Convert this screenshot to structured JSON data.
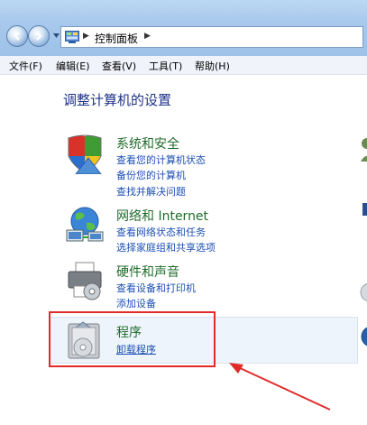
{
  "address_bar": {
    "path": "控制面板"
  },
  "menu": {
    "items": [
      "文件(F)",
      "编辑(E)",
      "查看(V)",
      "工具(T)",
      "帮助(H)"
    ]
  },
  "page": {
    "title": "调整计算机的设置"
  },
  "categories": [
    {
      "title": "系统和安全",
      "icon": "shield-icon",
      "links": [
        "查看您的计算机状态",
        "备份您的计算机",
        "查找并解决问题"
      ]
    },
    {
      "title": "网络和 Internet",
      "icon": "network-globe-icon",
      "links": [
        "查看网络状态和任务",
        "选择家庭组和共享选项"
      ]
    },
    {
      "title": "硬件和声音",
      "icon": "printer-icon",
      "links": [
        "查看设备和打印机",
        "添加设备"
      ]
    },
    {
      "title": "程序",
      "icon": "programs-icon",
      "links": [
        "卸载程序"
      ]
    }
  ],
  "colors": {
    "category_title": "#1f6b2a",
    "link": "#1c4fb3",
    "page_title": "#1e3287",
    "highlight_box": "#e02b2b",
    "arrow": "#e02b2b"
  }
}
